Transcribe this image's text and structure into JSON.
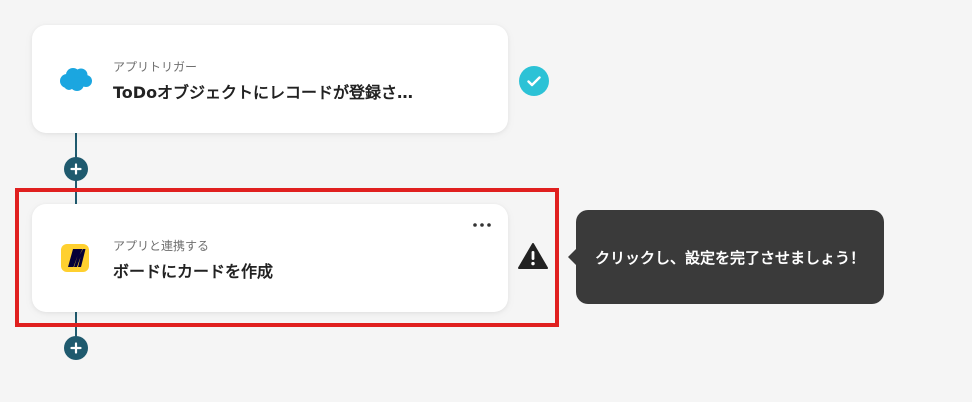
{
  "steps": [
    {
      "subtitle": "アプリトリガー",
      "title": "ToDoオブジェクトにレコードが登録さ…",
      "icon": "salesforce-cloud-icon",
      "status": "complete",
      "icon_color": "#1ba6e0"
    },
    {
      "subtitle": "アプリと連携する",
      "title": "ボードにカードを作成",
      "icon": "miro-logo-icon",
      "status": "incomplete",
      "icon_color": "#ffd02f"
    }
  ],
  "tooltip": {
    "text": "クリックし、設定を完了させましょう！"
  },
  "colors": {
    "connector": "#1f5a6e",
    "complete_badge": "#2cc2d6",
    "highlight": "#e0201f",
    "tooltip_bg": "#3a3a3a"
  }
}
